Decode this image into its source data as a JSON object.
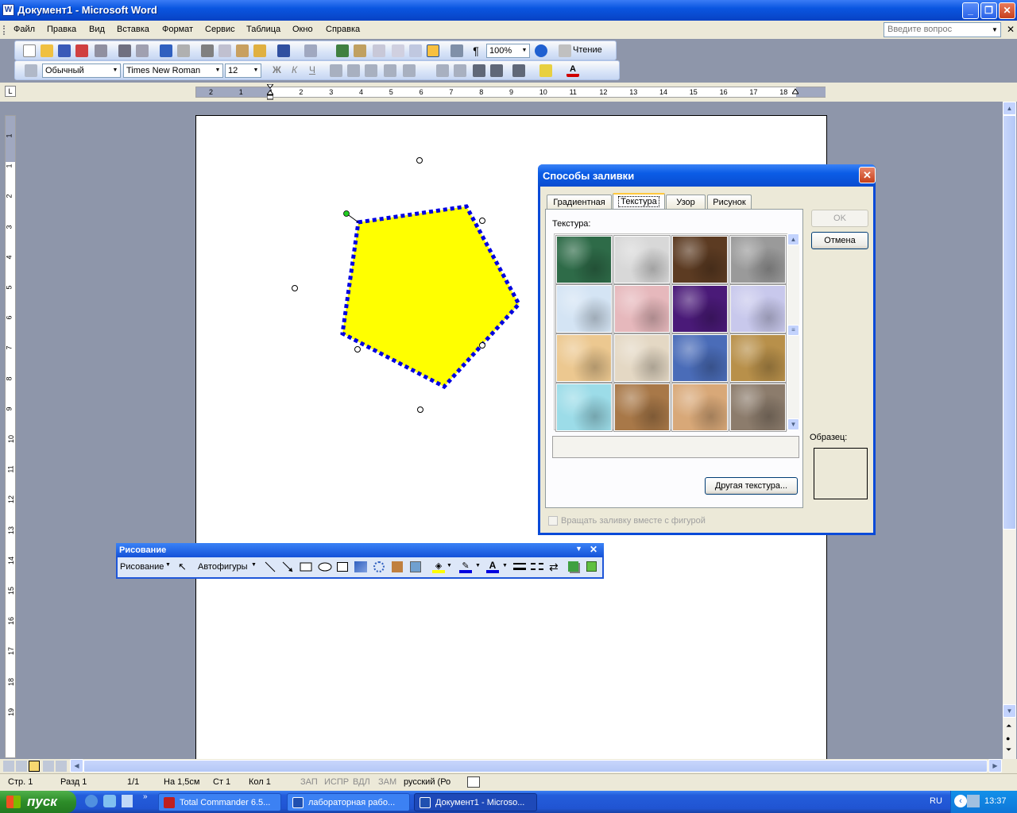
{
  "window": {
    "title": "Документ1 - Microsoft Word"
  },
  "menu": [
    "Файл",
    "Правка",
    "Вид",
    "Вставка",
    "Формат",
    "Сервис",
    "Таблица",
    "Окно",
    "Справка"
  ],
  "help_placeholder": "Введите вопрос",
  "toolbar": {
    "zoom": "100%",
    "reading": "Чтение",
    "style": "Обычный",
    "font": "Times New Roman",
    "size": "12",
    "bold": "Ж",
    "italic": "К",
    "underline": "Ч"
  },
  "ruler": {
    "h_numbers": [
      "2",
      "1",
      "1",
      "2",
      "3",
      "4",
      "5",
      "6",
      "7",
      "8",
      "9",
      "10",
      "11",
      "12",
      "13",
      "14",
      "15",
      "16",
      "17",
      "18"
    ],
    "v_numbers": [
      "1",
      "1",
      "2",
      "3",
      "4",
      "5",
      "6",
      "7",
      "8",
      "9",
      "10",
      "11",
      "12",
      "13",
      "14",
      "15",
      "16",
      "17",
      "18",
      "19"
    ]
  },
  "dialog": {
    "title": "Способы заливки",
    "tabs": [
      "Градиентная",
      "Текстура",
      "Узор",
      "Рисунок"
    ],
    "active_tab": "Текстура",
    "texture_label": "Текстура:",
    "other_texture": "Другая текстура...",
    "ok": "OK",
    "cancel": "Отмена",
    "sample_label": "Образец:",
    "rotate_checkbox": "Вращать заливку вместе с фигурой",
    "textures": [
      "green-marble",
      "white-marble",
      "brown-marble",
      "granite",
      "blue-tissue",
      "pink-tissue",
      "purple-mesh",
      "bouquet",
      "papyrus",
      "canvas",
      "denim",
      "woven-mat",
      "water-droplets",
      "paper-bag",
      "fish-fossil",
      "sand"
    ],
    "texture_colors": [
      "#2e6b48",
      "#d8d8d8",
      "#5c3b22",
      "#9a9a9a",
      "#d4e4f4",
      "#e6b8bc",
      "#4a1a78",
      "#c8c8ec",
      "#ecc890",
      "#e4d8c4",
      "#4a6cb8",
      "#b8904a",
      "#9cdce8",
      "#a87848",
      "#d8a878",
      "#8c7c6c"
    ]
  },
  "drawing_toolbar": {
    "title": "Рисование",
    "draw_menu": "Рисование",
    "autoshapes": "Автофигуры"
  },
  "statusbar": {
    "page": "Стр. 1",
    "section": "Разд 1",
    "pages": "1/1",
    "at": "На 1,5см",
    "line": "Ст 1",
    "col": "Кол 1",
    "rec": "ЗАП",
    "trk": "ИСПР",
    "ext": "ВДЛ",
    "ovr": "ЗАМ",
    "lang": "русский (Ро"
  },
  "taskbar": {
    "start": "пуск",
    "tasks": [
      "Total Commander 6.5...",
      "лабораторная рабо...",
      "Документ1 - Microso..."
    ],
    "lang": "RU",
    "time": "13:37"
  },
  "colors": {
    "shape_fill": "#ffff00",
    "shape_outline": "#0000e0",
    "titlebar": "#0a56e0"
  }
}
